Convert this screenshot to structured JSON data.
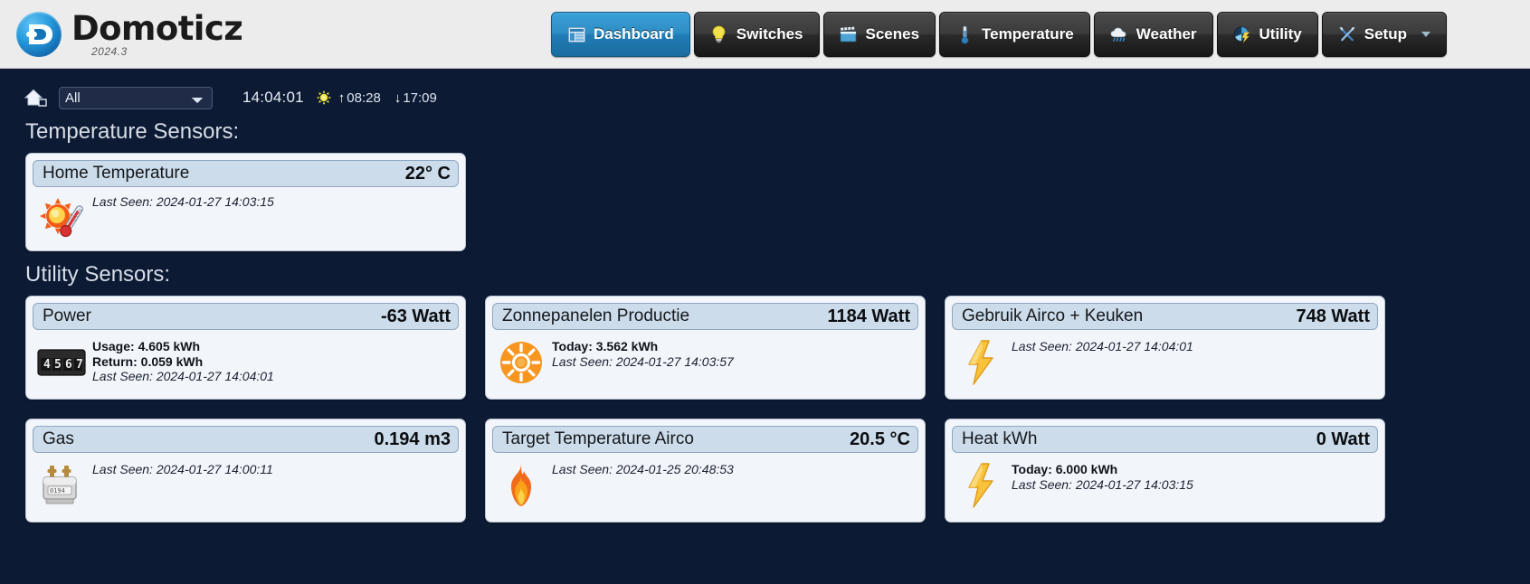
{
  "brand": {
    "name": "Domoticz",
    "version": "2024.3",
    "logo_icon": "domoticz-logo-icon"
  },
  "nav": {
    "tabs": [
      {
        "label": "Dashboard",
        "icon": "dashboard-icon",
        "active": true
      },
      {
        "label": "Switches",
        "icon": "lightbulb-icon",
        "active": false
      },
      {
        "label": "Scenes",
        "icon": "clapperboard-icon",
        "active": false
      },
      {
        "label": "Temperature",
        "icon": "thermometer-icon",
        "active": false
      },
      {
        "label": "Weather",
        "icon": "rain-cloud-icon",
        "active": false
      },
      {
        "label": "Utility",
        "icon": "meter-icon",
        "active": false
      },
      {
        "label": "Setup",
        "icon": "tools-icon",
        "active": false,
        "has_caret": true
      }
    ]
  },
  "toolbar": {
    "house_icon": "house-icon",
    "room_filter": {
      "selected": "All",
      "options": [
        "All"
      ]
    },
    "clock": "14:04:01",
    "sun_icon": "sun-icon",
    "sunrise_arrow": "↑",
    "sunrise": "08:28",
    "sunset_arrow": "↓",
    "sunset": "17:09"
  },
  "sections": [
    {
      "title": "Temperature Sensors:",
      "widgets": [
        {
          "title": "Home Temperature",
          "value": "22° C",
          "icon": "sun-thermometer-icon",
          "lines": [
            {
              "text": "Last Seen: 2024-01-27 14:03:15",
              "style": "italic"
            }
          ]
        }
      ]
    },
    {
      "title": "Utility Sensors:",
      "widgets": [
        {
          "title": "Power",
          "value": "-63 Watt",
          "icon": "electricity-meter-icon",
          "lines": [
            {
              "text": "Usage: 4.605 kWh",
              "style": "bold"
            },
            {
              "text": "Return: 0.059 kWh",
              "style": "bold"
            },
            {
              "text": "Last Seen: 2024-01-27 14:04:01",
              "style": "italic"
            }
          ]
        },
        {
          "title": "Zonnepanelen Productie",
          "value": "1184 Watt",
          "icon": "solar-sun-icon",
          "lines": [
            {
              "text": "Today: 3.562 kWh",
              "style": "bold"
            },
            {
              "text": "Last Seen: 2024-01-27 14:03:57",
              "style": "italic"
            }
          ]
        },
        {
          "title": "Gebruik Airco + Keuken",
          "value": "748 Watt",
          "icon": "lightning-bolt-icon",
          "lines": [
            {
              "text": "Last Seen: 2024-01-27 14:04:01",
              "style": "italic"
            }
          ]
        },
        {
          "title": "Gas",
          "value": "0.194 m3",
          "icon": "gas-meter-icon",
          "lines": [
            {
              "text": "Last Seen: 2024-01-27 14:00:11",
              "style": "italic"
            }
          ]
        },
        {
          "title": "Target Temperature Airco",
          "value": "20.5 °C",
          "icon": "flame-icon",
          "lines": [
            {
              "text": "Last Seen: 2024-01-25 20:48:53",
              "style": "italic"
            }
          ]
        },
        {
          "title": "Heat kWh",
          "value": "0 Watt",
          "icon": "lightning-bolt-icon",
          "lines": [
            {
              "text": "Today: 6.000 kWh",
              "style": "bold"
            },
            {
              "text": "Last Seen: 2024-01-27 14:03:15",
              "style": "italic"
            }
          ]
        }
      ]
    }
  ],
  "colors": {
    "page_background": "#0c1a33",
    "header_background": "#ececec",
    "accent_active_tab": "#2e8cc4",
    "widget_background": "#f2f5fa",
    "widget_header": "#ccdcea"
  }
}
